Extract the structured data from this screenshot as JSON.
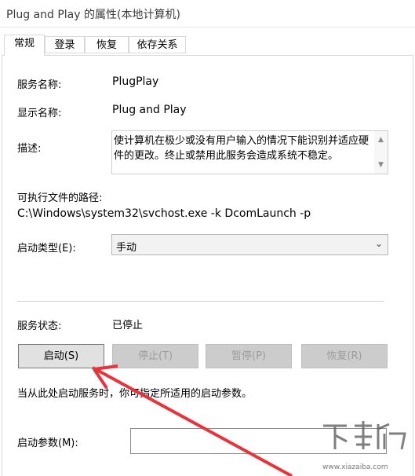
{
  "window": {
    "title": "Plug and Play 的属性(本地计算机)"
  },
  "tabs": [
    {
      "label": "常规",
      "active": true
    },
    {
      "label": "登录",
      "active": false
    },
    {
      "label": "恢复",
      "active": false
    },
    {
      "label": "依存关系",
      "active": false
    }
  ],
  "general": {
    "service_name_label": "服务名称:",
    "service_name_value": "PlugPlay",
    "display_name_label": "显示名称:",
    "display_name_value": "Plug and Play",
    "description_label": "描述:",
    "description_value": "使计算机在极少或没有用户输入的情况下能识别并适应硬件的更改。终止或禁用此服务会造成系统不稳定。",
    "exe_path_label": "可执行文件的路径:",
    "exe_path_value": "C:\\Windows\\system32\\svchost.exe -k DcomLaunch -p",
    "startup_type_label": "启动类型(E):",
    "startup_type_value": "手动",
    "service_status_label": "服务状态:",
    "service_status_value": "已停止",
    "buttons": {
      "start": "启动(S)",
      "stop": "停止(T)",
      "pause": "暂停(P)",
      "resume": "恢复(R)"
    },
    "hint_text": "当从此处启动服务时，你可指定所适用的启动参数。",
    "start_params_label": "启动参数(M):",
    "start_params_value": ""
  },
  "colors": {
    "annotation_arrow": "#e8333a"
  },
  "watermark": {
    "text": "www.xiazaiba.com"
  }
}
